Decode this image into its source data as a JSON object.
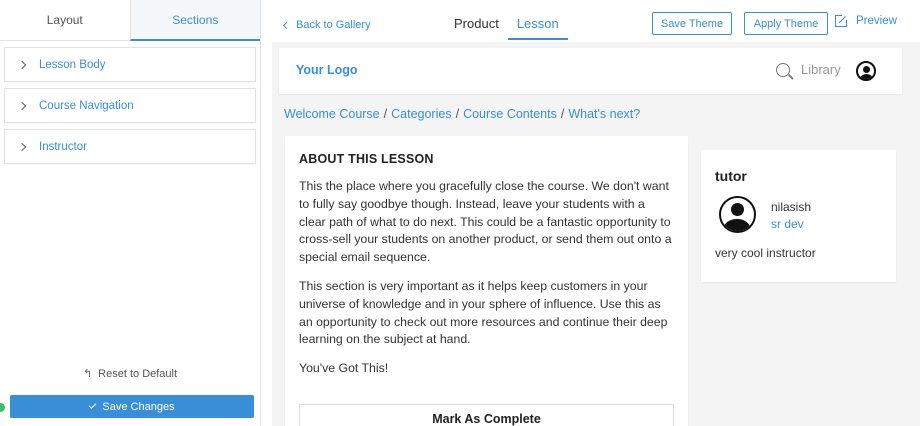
{
  "sidebar": {
    "tabs": [
      {
        "label": "Layout",
        "active": false
      },
      {
        "label": "Sections",
        "active": true
      }
    ],
    "sections": [
      {
        "label": "Lesson Body"
      },
      {
        "label": "Course Navigation"
      },
      {
        "label": "Instructor"
      }
    ],
    "reset_label": "Reset to Default",
    "save_label": "Save Changes"
  },
  "topbar": {
    "back_label": "Back to Gallery",
    "tabs": [
      {
        "label": "Product",
        "active": false
      },
      {
        "label": "Lesson",
        "active": true
      }
    ],
    "save_theme_label": "Save Theme",
    "apply_theme_label": "Apply Theme",
    "preview_label": "Preview"
  },
  "site": {
    "logo": "Your Logo",
    "library_label": "Library",
    "breadcrumb": [
      "Welcome Course",
      "Categories",
      "Course Contents",
      "What's next?"
    ],
    "breadcrumb_sep": "/"
  },
  "lesson": {
    "heading": "ABOUT THIS LESSON",
    "paragraphs": [
      "This the place where you gracefully close the course. We don't want to fully say goodbye though. Instead, leave your students with a clear path of what to do next. This could be a fantastic opportunity to cross-sell your students on another product, or send them out onto a special email sequence.",
      "This section is very important as it helps keep customers in your universe of knowledge and in your sphere of influence. Use this as an opportunity to check out more resources and continue their deep learning on the subject at hand.",
      "You've Got This!"
    ],
    "complete_label": "Mark As Complete"
  },
  "instructor": {
    "heading": "tutor",
    "name": "nilasish",
    "role": "sr dev",
    "description": "very cool instructor"
  },
  "colors": {
    "accent": "#3a8ed8",
    "status_dot": "#3cbf6a",
    "canvas_bg": "#f4f4f4"
  }
}
